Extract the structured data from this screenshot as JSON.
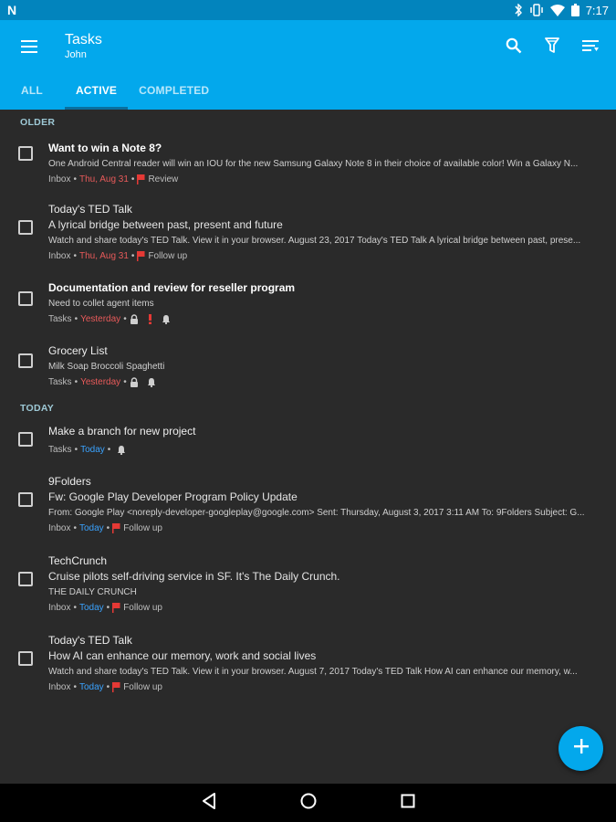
{
  "status_bar": {
    "time": "7:17",
    "app_icon": "N"
  },
  "header": {
    "title": "Tasks",
    "subtitle": "John"
  },
  "tabs": [
    {
      "label": "ALL",
      "active": false
    },
    {
      "label": "ACTIVE",
      "active": true
    },
    {
      "label": "COMPLETED",
      "active": false
    }
  ],
  "sections": [
    {
      "label": "OLDER",
      "tasks": [
        {
          "title": "Want to win a Note 8?",
          "snippet": "One Android Central reader will win an IOU for the new Samsung Galaxy Note 8 in their choice of available color! Win a Galaxy N...",
          "folder": "Inbox",
          "date": "Thu, Aug 31",
          "tag": "Review"
        },
        {
          "title": "Today's TED Talk",
          "headline": "A lyrical bridge between past, present and future",
          "snippet": "Watch and share today's TED Talk. View it in your browser. August 23, 2017 Today's TED Talk A lyrical bridge between past, prese...",
          "folder": "Inbox",
          "date": "Thu, Aug 31",
          "tag": "Follow up"
        },
        {
          "title": "Documentation and review for reseller program",
          "snippet": "Need to collet agent items",
          "folder": "Tasks",
          "date": "Yesterday"
        },
        {
          "title": "Grocery List",
          "snippet": "Milk Soap Broccoli Spaghetti",
          "folder": "Tasks",
          "date": "Yesterday"
        }
      ]
    },
    {
      "label": "TODAY",
      "tasks": [
        {
          "title": "Make a branch for new project",
          "folder": "Tasks",
          "date": "Today"
        },
        {
          "title": "9Folders",
          "headline": "Fw: Google Play Developer Program Policy Update",
          "snippet": "From: Google Play <noreply-developer-googleplay@google.com> Sent: Thursday, August 3, 2017 3:11 AM To: 9Folders Subject: G...",
          "folder": "Inbox",
          "date": "Today",
          "tag": "Follow up"
        },
        {
          "title": "TechCrunch",
          "headline": "Cruise pilots self-driving service in SF. It's The Daily Crunch.",
          "snippet": "THE DAILY CRUNCH",
          "folder": "Inbox",
          "date": "Today",
          "tag": "Follow up"
        },
        {
          "title": "Today's TED Talk",
          "headline": "How AI can enhance our memory, work and social lives",
          "snippet": "Watch and share today's TED Talk. View it in your browser. August 7, 2017 Today's TED Talk How AI can enhance our memory, w...",
          "folder": "Inbox",
          "date": "Today",
          "tag": "Follow up"
        }
      ]
    }
  ],
  "separator": " • ",
  "colors": {
    "accent": "#03a8ec",
    "status_bar": "#0284bd",
    "background": "#2a2a2a",
    "overdue": "#e85a5a",
    "today": "#3aa3ff",
    "flag": "#e53935"
  },
  "icons": [
    "menu-icon",
    "search-icon",
    "filter-icon",
    "sort-icon",
    "flag-icon",
    "lock-icon",
    "priority-icon",
    "bell-icon",
    "add-icon",
    "back-icon",
    "home-icon",
    "recents-icon"
  ]
}
